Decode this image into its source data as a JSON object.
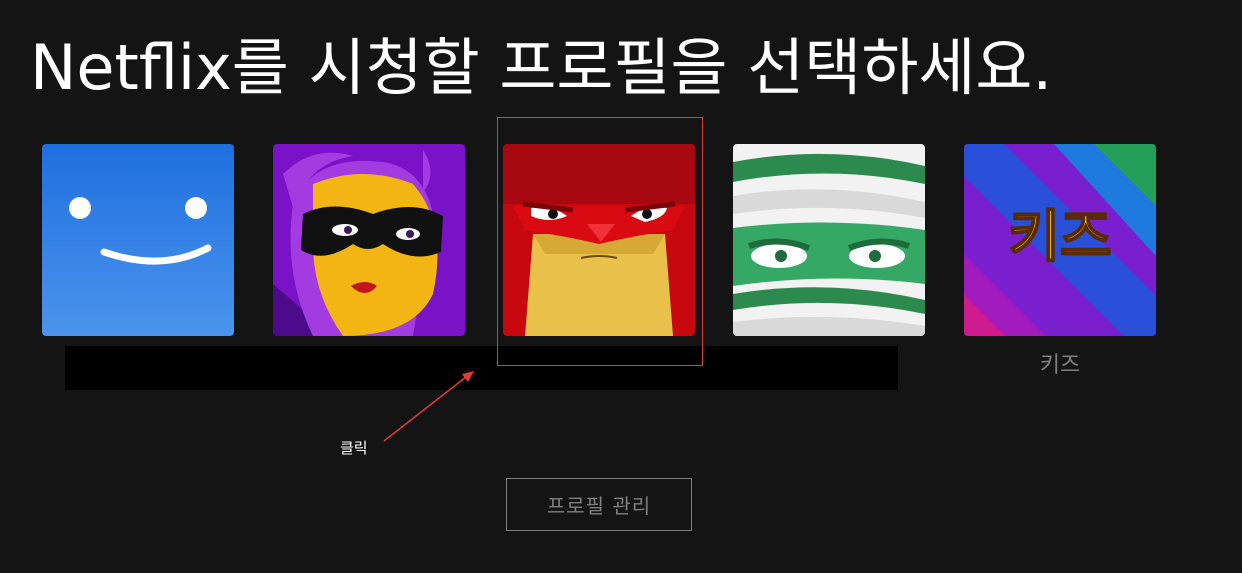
{
  "page": {
    "title": "Netflix를 시청할 프로필을 선택하세요."
  },
  "profiles": [
    {
      "avatar_icon": "smiley-face-icon",
      "color": "#2a7fe0"
    },
    {
      "avatar_icon": "masked-woman-icon",
      "color": "#7b12c9"
    },
    {
      "avatar_icon": "angry-red-hero-icon",
      "color": "#d90a12"
    },
    {
      "avatar_icon": "green-bandaged-face-icon",
      "color": "#2e9e5c"
    },
    {
      "avatar_icon": "kids-icon",
      "avatar_text": "키즈",
      "label": "키즈",
      "color": "#e6c430"
    }
  ],
  "annotation": {
    "click_note": "클릭",
    "color": "#e03b3b"
  },
  "manage_button": {
    "label": "프로필 관리"
  }
}
